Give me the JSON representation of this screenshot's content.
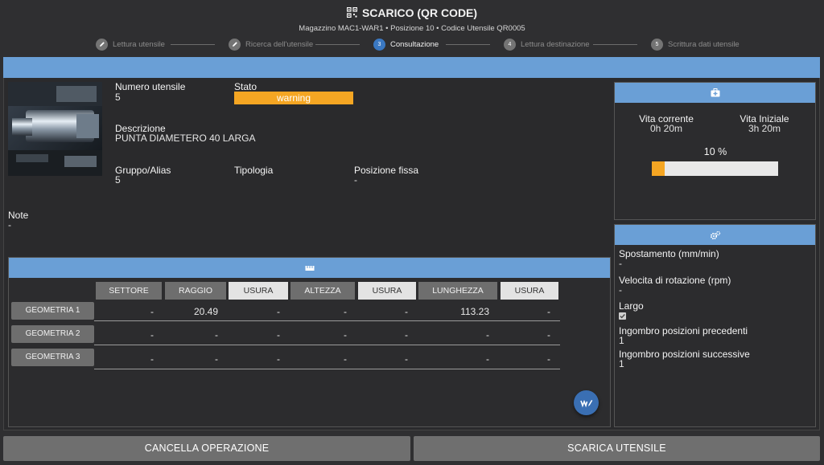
{
  "header": {
    "title": "SCARICO (QR CODE)",
    "subtitle": "Magazzino MAC1-WAR1 • Posizione 10 • Codice Utensile QR0005"
  },
  "steps": [
    {
      "num": "",
      "label": "Lettura utensile",
      "icon": "pencil-icon",
      "state": "done"
    },
    {
      "num": "",
      "label": "Ricerca dell'utensile",
      "icon": "pencil-icon",
      "state": "done"
    },
    {
      "num": "3",
      "label": "Consultazione",
      "icon": "",
      "state": "active"
    },
    {
      "num": "4",
      "label": "Lettura destinazione",
      "icon": "",
      "state": "todo"
    },
    {
      "num": "5",
      "label": "Scrittura dati utensile",
      "icon": "",
      "state": "todo"
    }
  ],
  "tool": {
    "numero_label": "Numero utensile",
    "numero_value": "5",
    "stato_label": "Stato",
    "stato_value": "warning",
    "descrizione_label": "Descrizione",
    "descrizione_value": "PUNTA DIAMETERO 40 LARGA",
    "gruppo_label": "Gruppo/Alias",
    "gruppo_value": "5",
    "tipologia_label": "Tipologia",
    "tipologia_value": "",
    "posizione_label": "Posizione fissa",
    "posizione_value": "-",
    "note_label": "Note",
    "note_value": "-"
  },
  "life": {
    "icon": "medkit-icon",
    "corrente_label": "Vita corrente",
    "corrente_value": "0h 20m",
    "iniziale_label": "Vita Iniziale",
    "iniziale_value": "3h 20m",
    "percent_text": "10 %",
    "percent": 0.1,
    "bar_color": "#f5a623"
  },
  "params": {
    "icon": "gears-icon",
    "spostamento_label": "Spostamento (mm/min)",
    "spostamento_value": "-",
    "velocita_label": "Velocita di rotazione (rpm)",
    "velocita_value": "-",
    "largo_label": "Largo",
    "largo_checked": true,
    "precedenti_label": "Ingombro posizioni precedenti",
    "precedenti_value": "1",
    "successive_label": "Ingombro posizioni successive",
    "successive_value": "1"
  },
  "geometry": {
    "icon": "ruler-icon",
    "columns": [
      "SETTORE",
      "RAGGIO",
      "USURA",
      "ALTEZZA",
      "USURA",
      "LUNGHEZZA",
      "USURA"
    ],
    "rows": [
      {
        "label": "GEOMETRIA 1",
        "values": [
          "-",
          "20.49",
          "-",
          "-",
          "-",
          "113.23",
          "-"
        ]
      },
      {
        "label": "GEOMETRIA 2",
        "values": [
          "-",
          "-",
          "-",
          "-",
          "-",
          "-",
          "-"
        ]
      },
      {
        "label": "GEOMETRIA 3",
        "values": [
          "-",
          "-",
          "-",
          "-",
          "-",
          "-",
          "-"
        ]
      }
    ],
    "fab_icon": "edit-measure-icon"
  },
  "actions": {
    "cancel_label": "CANCELLA OPERAZIONE",
    "unload_label": "SCARICA UTENSILE"
  },
  "colors": {
    "accent": "#6a9fd6",
    "active_step": "#3a78c2",
    "warning": "#f5a623",
    "background": "#2f2f31"
  }
}
